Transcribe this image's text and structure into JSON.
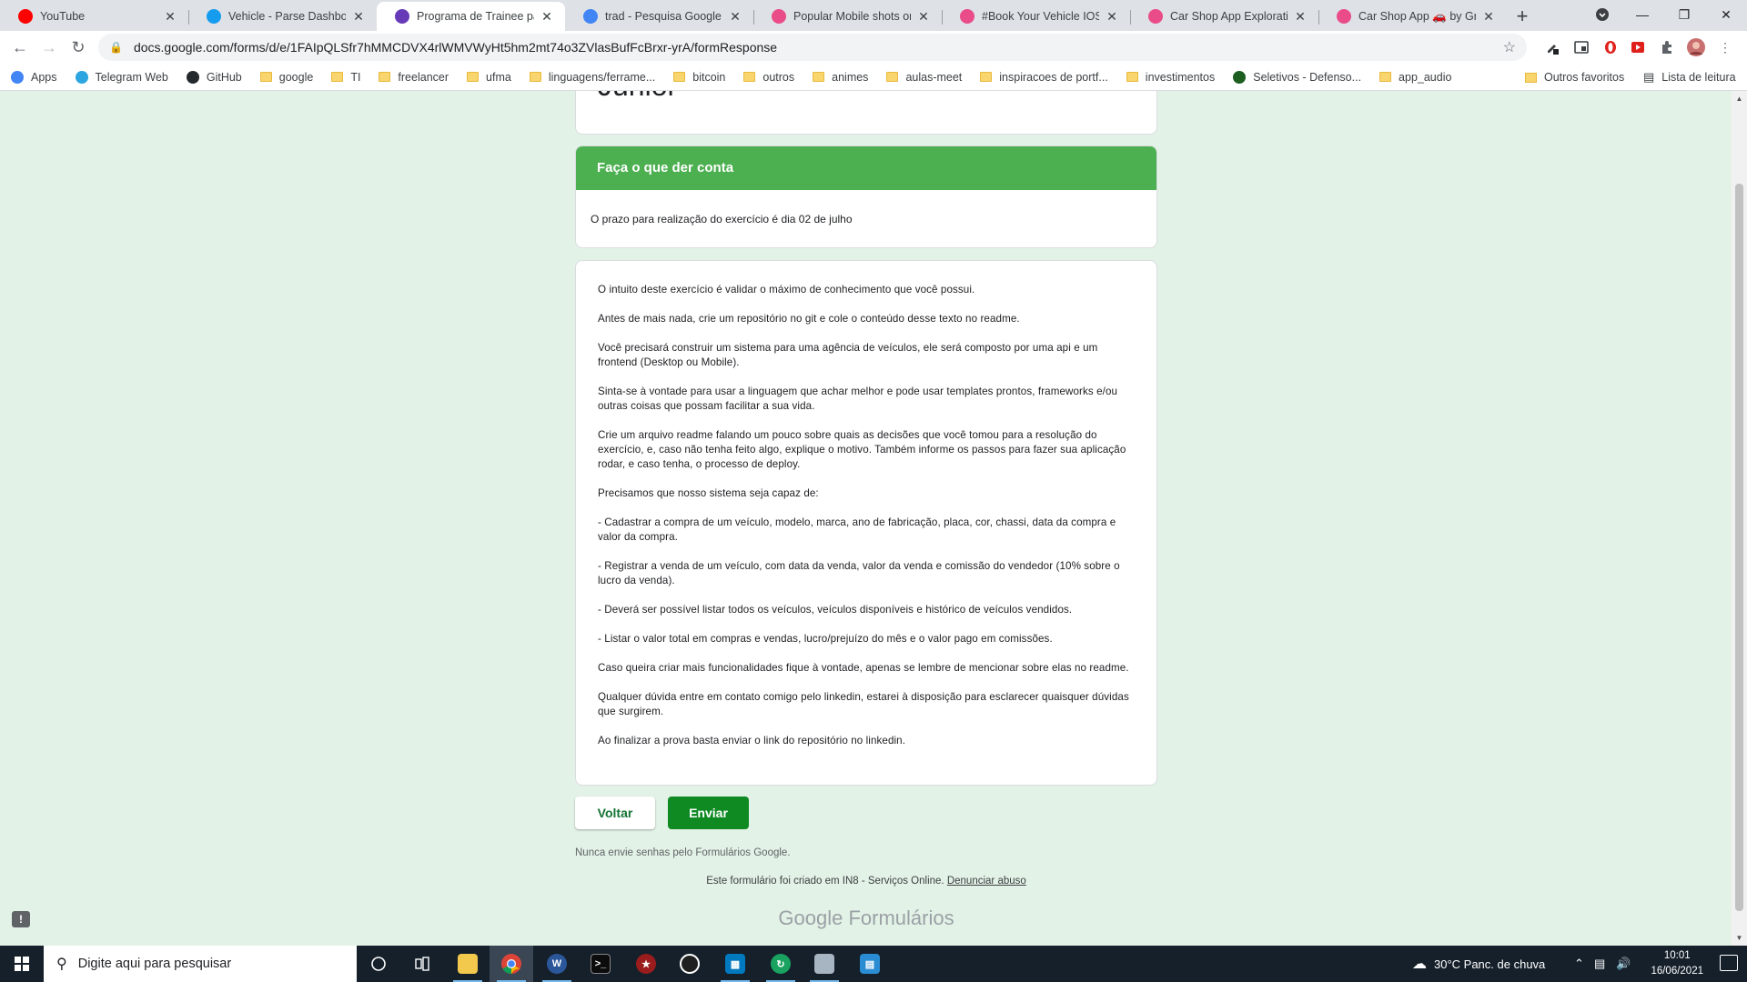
{
  "tabs": [
    {
      "title": "YouTube",
      "icon": "youtube-icon",
      "color": "#ff0000"
    },
    {
      "title": "Vehicle - Parse Dashboard",
      "icon": "parse-icon",
      "color": "#169cee"
    },
    {
      "title": "Programa de Trainee para",
      "icon": "google-forms-icon",
      "color": "#673ab7",
      "active": true
    },
    {
      "title": "trad - Pesquisa Google",
      "icon": "google-icon",
      "color": "#4285f4"
    },
    {
      "title": "Popular Mobile shots on D",
      "icon": "dribbble-icon",
      "color": "#ea4c89"
    },
    {
      "title": "#Book Your Vehicle IOS Ap",
      "icon": "dribbble-icon",
      "color": "#ea4c89"
    },
    {
      "title": "Car Shop App Exploration",
      "icon": "dribbble-icon",
      "color": "#ea4c89"
    },
    {
      "title": "Car Shop App 🚗 by Greg",
      "icon": "dribbble-icon",
      "color": "#ea4c89"
    }
  ],
  "url": "docs.google.com/forms/d/e/1FAIpQLSfr7hMMCDVX4rlWMVWyHt5hm2mt74o3ZVlasBufFcBrxr-yrA/formResponse",
  "bookmarks": [
    {
      "label": "Apps",
      "icon": "apps-icon"
    },
    {
      "label": "Telegram Web",
      "icon": "telegram-icon"
    },
    {
      "label": "GitHub",
      "icon": "github-icon"
    },
    {
      "label": "google",
      "icon": "folder-icon"
    },
    {
      "label": "TI",
      "icon": "folder-icon"
    },
    {
      "label": "freelancer",
      "icon": "folder-icon"
    },
    {
      "label": "ufma",
      "icon": "folder-icon"
    },
    {
      "label": "linguagens/ferrame...",
      "icon": "folder-icon"
    },
    {
      "label": "bitcoin",
      "icon": "folder-icon"
    },
    {
      "label": "outros",
      "icon": "folder-icon"
    },
    {
      "label": "animes",
      "icon": "folder-icon"
    },
    {
      "label": "aulas-meet",
      "icon": "folder-icon"
    },
    {
      "label": "inspiracoes de portf...",
      "icon": "folder-icon"
    },
    {
      "label": "investimentos",
      "icon": "folder-icon"
    },
    {
      "label": "Seletivos - Defenso...",
      "icon": "defensoria-icon"
    },
    {
      "label": "app_audio",
      "icon": "folder-icon"
    }
  ],
  "bookmarks_right": {
    "other": "Outros favoritos",
    "reading": "Lista de leitura"
  },
  "form": {
    "title_fragment": "Junior",
    "section_title": "Faça o que der conta",
    "section_description": "O prazo para realização do exercício é dia 02 de julho",
    "paragraphs": [
      "O intuito deste exercício é validar o máximo de conhecimento que você possui.",
      "Antes de mais nada, crie um repositório no git e cole o conteúdo desse texto no readme.",
      "Você precisará construir um sistema para uma agência de veículos, ele será composto por uma api e um frontend (Desktop ou Mobile).",
      "Sinta-se à vontade para usar a linguagem que achar melhor e pode usar templates prontos, frameworks e/ou outras coisas que possam facilitar a sua vida.",
      "Crie um arquivo readme falando um pouco sobre quais as decisões que você tomou para a resolução do exercício, e, caso não tenha feito algo, explique o motivo. Também informe os passos para fazer sua aplicação rodar, e caso tenha, o processo de deploy.",
      "Precisamos que nosso sistema seja capaz de:",
      "- Cadastrar a compra de um veículo, modelo, marca, ano de fabricação, placa, cor, chassi, data da compra e valor da compra.",
      "- Registrar a venda de um veículo, com data da venda, valor da venda e comissão do vendedor (10% sobre o lucro da venda).",
      "- Deverá ser possível listar todos os veículos, veículos disponíveis e histórico de veículos vendidos.",
      "- Listar o valor total em compras e vendas, lucro/prejuízo do mês e o valor pago em comissões.",
      "Caso queira criar mais funcionalidades fique à vontade, apenas se lembre de mencionar sobre elas no readme.",
      "Qualquer dúvida entre em contato comigo pelo linkedin, estarei à disposição para esclarecer quaisquer dúvidas que surgirem.",
      "Ao finalizar a prova basta enviar o link do repositório no linkedin."
    ],
    "back_label": "Voltar",
    "submit_label": "Enviar",
    "password_note": "Nunca envie senhas pelo Formulários Google.",
    "created_text": "Este formulário foi criado em IN8 - Serviços Online.",
    "report_link": "Denunciar abuso",
    "brand_google": "Google",
    "brand_forms": "Formulários",
    "theme_color": "#4caf50",
    "background_color": "#e3f2e6"
  },
  "taskbar": {
    "search_placeholder": "Digite aqui para pesquisar",
    "weather": "30°C  Panc. de chuva",
    "time": "10:01",
    "date": "16/06/2021"
  }
}
